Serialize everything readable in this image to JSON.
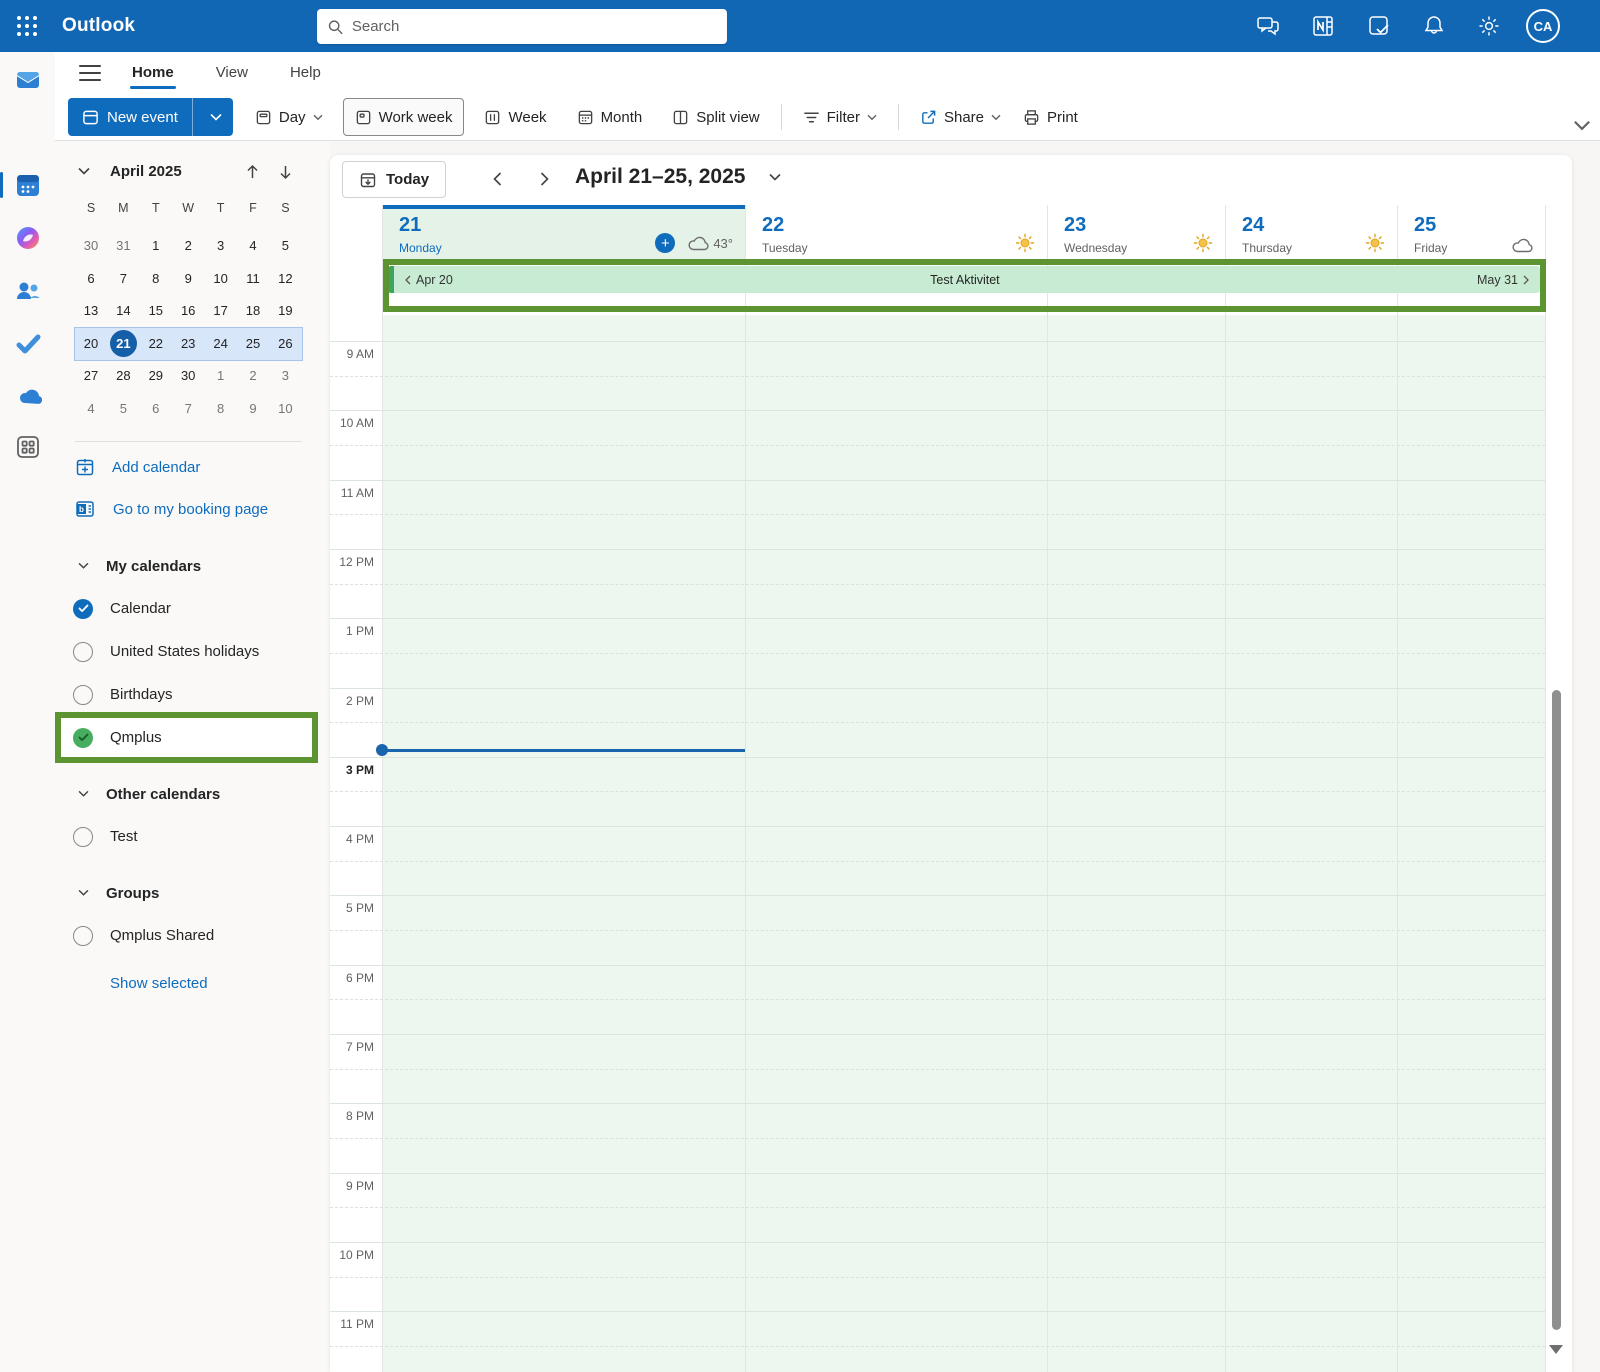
{
  "topbar": {
    "brand": "Outlook",
    "search_placeholder": "Search",
    "avatar_initials": "CA",
    "icons": [
      "chat-icon",
      "onenote-icon",
      "todo-check-icon",
      "bell-icon",
      "settings-gear-icon"
    ]
  },
  "ribbon": {
    "tabs": [
      {
        "label": "Home",
        "active": true
      },
      {
        "label": "View",
        "active": false
      },
      {
        "label": "Help",
        "active": false
      }
    ],
    "toolbar": {
      "new_event": "New event",
      "day": "Day",
      "work_week": "Work week",
      "week": "Week",
      "month": "Month",
      "split_view": "Split view",
      "filter": "Filter",
      "share": "Share",
      "print": "Print"
    }
  },
  "rail_items": [
    "mail-icon",
    "calendar-icon",
    "copilot-icon",
    "people-icon",
    "todo-icon",
    "onedrive-icon",
    "apps-icon"
  ],
  "sidebar": {
    "mini_calendar": {
      "title": "April 2025",
      "weekdays": [
        "S",
        "M",
        "T",
        "W",
        "T",
        "F",
        "S"
      ],
      "selected_day": "21",
      "rows": [
        {
          "highlighted": false,
          "cells": [
            {
              "d": "30",
              "muted": true
            },
            {
              "d": "31",
              "muted": true
            },
            {
              "d": "1",
              "muted": false
            },
            {
              "d": "2",
              "muted": false
            },
            {
              "d": "3",
              "muted": false
            },
            {
              "d": "4",
              "muted": false
            },
            {
              "d": "5",
              "muted": false
            }
          ]
        },
        {
          "highlighted": false,
          "cells": [
            {
              "d": "6",
              "muted": false
            },
            {
              "d": "7",
              "muted": false
            },
            {
              "d": "8",
              "muted": false
            },
            {
              "d": "9",
              "muted": false
            },
            {
              "d": "10",
              "muted": false
            },
            {
              "d": "11",
              "muted": false
            },
            {
              "d": "12",
              "muted": false
            }
          ]
        },
        {
          "highlighted": false,
          "cells": [
            {
              "d": "13",
              "muted": false
            },
            {
              "d": "14",
              "muted": false
            },
            {
              "d": "15",
              "muted": false
            },
            {
              "d": "16",
              "muted": false
            },
            {
              "d": "17",
              "muted": false
            },
            {
              "d": "18",
              "muted": false
            },
            {
              "d": "19",
              "muted": false
            }
          ]
        },
        {
          "highlighted": true,
          "cells": [
            {
              "d": "20",
              "muted": false
            },
            {
              "d": "21",
              "muted": false,
              "selected": true
            },
            {
              "d": "22",
              "muted": false
            },
            {
              "d": "23",
              "muted": false
            },
            {
              "d": "24",
              "muted": false
            },
            {
              "d": "25",
              "muted": false
            },
            {
              "d": "26",
              "muted": false
            }
          ]
        },
        {
          "highlighted": false,
          "cells": [
            {
              "d": "27",
              "muted": false
            },
            {
              "d": "28",
              "muted": false
            },
            {
              "d": "29",
              "muted": false
            },
            {
              "d": "30",
              "muted": false
            },
            {
              "d": "1",
              "muted": true
            },
            {
              "d": "2",
              "muted": true
            },
            {
              "d": "3",
              "muted": true
            }
          ]
        },
        {
          "highlighted": false,
          "cells": [
            {
              "d": "4",
              "muted": true
            },
            {
              "d": "5",
              "muted": true
            },
            {
              "d": "6",
              "muted": true
            },
            {
              "d": "7",
              "muted": true
            },
            {
              "d": "8",
              "muted": true
            },
            {
              "d": "9",
              "muted": true
            },
            {
              "d": "10",
              "muted": true
            }
          ]
        }
      ]
    },
    "links": [
      {
        "label": "Add calendar",
        "icon": "add-calendar-icon"
      },
      {
        "label": "Go to my booking page",
        "icon": "booking-page-icon"
      }
    ],
    "sections": [
      {
        "title": "My calendars",
        "items": [
          {
            "label": "Calendar",
            "checked": true,
            "check_color": "#0f6cbd",
            "highlighted": false
          },
          {
            "label": "United States holidays",
            "checked": false,
            "highlighted": false
          },
          {
            "label": "Birthdays",
            "checked": false,
            "highlighted": false
          },
          {
            "label": "Qmplus",
            "checked": true,
            "check_color": "#47ae60",
            "highlighted": true
          }
        ]
      },
      {
        "title": "Other calendars",
        "items": [
          {
            "label": "Test",
            "checked": false,
            "highlighted": false
          }
        ]
      },
      {
        "title": "Groups",
        "items": [
          {
            "label": "Qmplus Shared",
            "checked": false,
            "highlighted": false
          }
        ]
      }
    ],
    "show_selected": "Show selected"
  },
  "calendar": {
    "today_button": "Today",
    "range_title": "April 21–25, 2025",
    "days": [
      {
        "number": "21",
        "name": "Monday",
        "today": true,
        "weather": "cloud",
        "temp": "43°",
        "has_add_button": true
      },
      {
        "number": "22",
        "name": "Tuesday",
        "today": false,
        "weather": "sun",
        "temp": "",
        "has_add_button": false
      },
      {
        "number": "23",
        "name": "Wednesday",
        "today": false,
        "weather": "sun",
        "temp": "",
        "has_add_button": false
      },
      {
        "number": "24",
        "name": "Thursday",
        "today": false,
        "weather": "sun",
        "temp": "",
        "has_add_button": false
      },
      {
        "number": "25",
        "name": "Friday",
        "today": false,
        "weather": "cloud",
        "temp": "",
        "has_add_button": false
      }
    ],
    "all_day_event": {
      "start_label": "Apr 20",
      "title": "Test Aktivitet",
      "end_label": "May 31"
    },
    "time_labels": [
      "9 AM",
      "10 AM",
      "11 AM",
      "12 PM",
      "1 PM",
      "2 PM",
      "3 PM",
      "4 PM",
      "5 PM",
      "6 PM",
      "7 PM",
      "8 PM",
      "9 PM",
      "10 PM",
      "11 PM"
    ],
    "current_hour_label": "3 PM"
  },
  "annotation_color": "#5d9432",
  "accent_color": "#0f6cbd",
  "event_color": "#c7ecd3"
}
